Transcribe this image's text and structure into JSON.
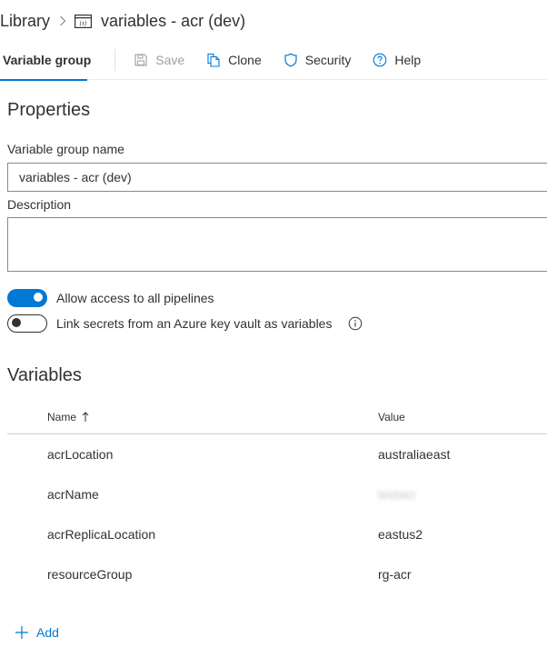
{
  "breadcrumb": {
    "root": "Library",
    "separator_icon": "chevron-right-icon",
    "library_icon": "variable-group-icon",
    "current": "variables - acr (dev)"
  },
  "toolbar": {
    "tab_label": "Variable group",
    "save_label": "Save",
    "clone_label": "Clone",
    "security_label": "Security",
    "help_label": "Help"
  },
  "properties": {
    "title": "Properties",
    "name_label": "Variable group name",
    "name_value": "variables - acr (dev)",
    "description_label": "Description",
    "description_value": ""
  },
  "toggles": {
    "allow_access_label": "Allow access to all pipelines",
    "allow_access_on": true,
    "link_secrets_label": "Link secrets from an Azure key vault as variables",
    "link_secrets_on": false
  },
  "variables": {
    "title": "Variables",
    "columns": {
      "name": "Name",
      "value": "Value"
    },
    "rows": [
      {
        "name": "acrLocation",
        "value": "australiaeast"
      },
      {
        "name": "acrName",
        "value": "testacr"
      },
      {
        "name": "acrReplicaLocation",
        "value": "eastus2"
      },
      {
        "name": "resourceGroup",
        "value": "rg-acr"
      }
    ],
    "add_label": "Add"
  },
  "colors": {
    "accent": "#0078d4",
    "text": "#323130",
    "disabled": "#a19f9d"
  }
}
